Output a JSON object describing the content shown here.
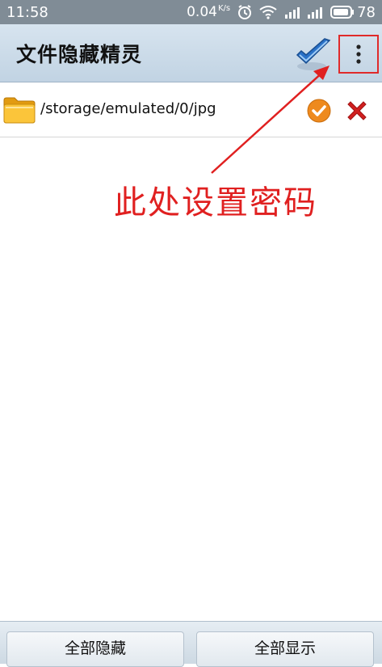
{
  "status_bar": {
    "time": "11:58",
    "net_speed": "0.04",
    "net_unit": "K/s",
    "battery": "78",
    "icons": [
      "alarm-icon",
      "wifi-icon",
      "signal-4g-icon",
      "signal-icon",
      "battery-icon"
    ]
  },
  "app_bar": {
    "title": "文件隐藏精灵",
    "logo_icon": "blue-check-icon",
    "menu_icon": "more-vert-icon"
  },
  "list": {
    "items": [
      {
        "icon": "folder-icon",
        "path": "/storage/emulated/0/jpg"
      }
    ]
  },
  "annotation": {
    "text": "此处设置密码",
    "color": "#e02020"
  },
  "bottom_bar": {
    "hide_all": "全部隐藏",
    "show_all": "全部显示"
  },
  "colors": {
    "status_bar": "#808c96",
    "app_bar": "#c9d9e8",
    "highlight_box": "#e02a2a"
  }
}
